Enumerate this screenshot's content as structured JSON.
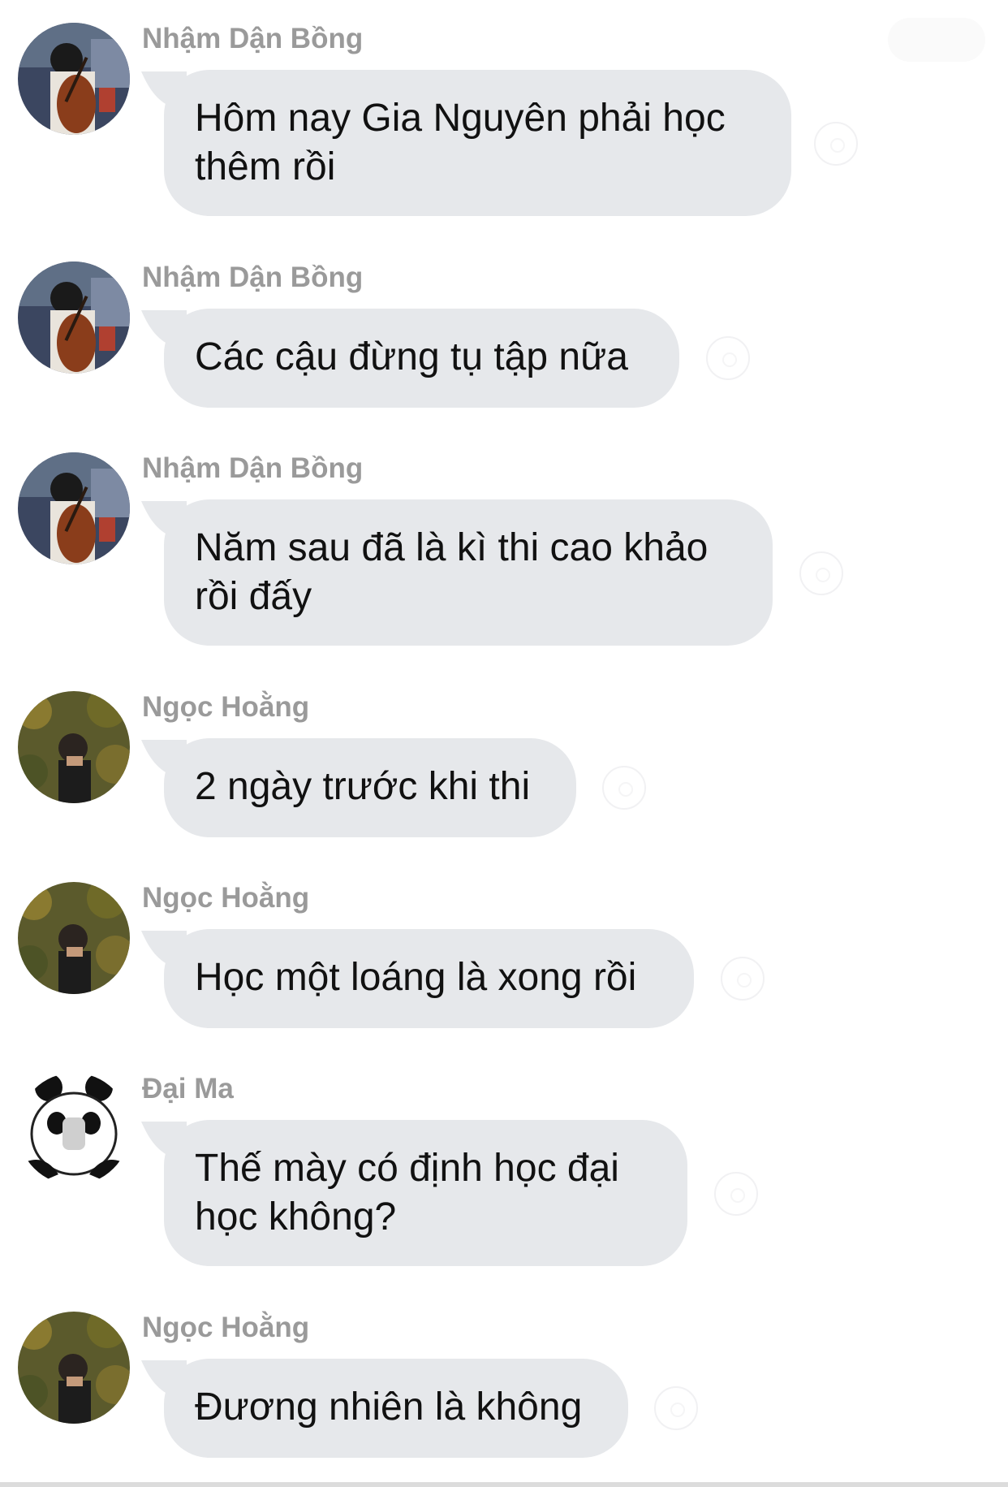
{
  "messages": [
    {
      "sender": "Nhậm Dận Bồng",
      "avatar": "cellist-avatar",
      "lines": [
        "Hôm nay Gia Nguyên phải học",
        "thêm rồi"
      ]
    },
    {
      "sender": "Nhậm Dận Bồng",
      "avatar": "cellist-avatar",
      "lines": [
        "Các cậu đừng tụ tập nữa"
      ]
    },
    {
      "sender": "Nhậm Dận Bồng",
      "avatar": "cellist-avatar",
      "lines": [
        "Năm sau đã là kì thi cao khảo",
        "rồi đấy"
      ]
    },
    {
      "sender": "Ngọc Hoằng",
      "avatar": "tree-portrait-avatar",
      "lines": [
        "2 ngày trước khi thi"
      ]
    },
    {
      "sender": "Ngọc Hoằng",
      "avatar": "tree-portrait-avatar",
      "lines": [
        "Học một loáng là xong rồi"
      ]
    },
    {
      "sender": "Đại Ma",
      "avatar": "panda-meme-avatar",
      "lines": [
        "Thế mày có định học đại",
        "học không?"
      ]
    },
    {
      "sender": "Ngọc Hoằng",
      "avatar": "tree-portrait-avatar",
      "lines": [
        "Đương nhiên là không"
      ]
    }
  ],
  "colors": {
    "bubble": "#e6e8eb",
    "sender_text": "#9a9a9a",
    "message_text": "#111111",
    "background": "#ffffff"
  },
  "icons": {
    "reaction": "smiley-reaction-icon"
  }
}
